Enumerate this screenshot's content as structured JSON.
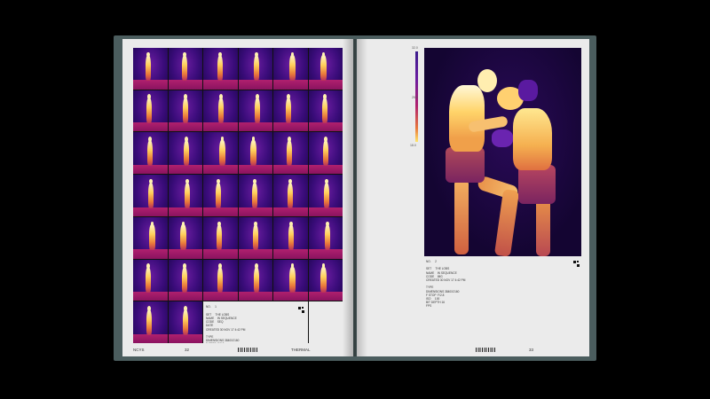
{
  "book": {
    "left_page": {
      "footer_left": "NCYS",
      "page_number": "32",
      "section": "THERMAL",
      "info_block": "NO.     1\n\nSET     THE LOBS\nNAME    IN SEQUENCE\nCODE    SEQ\nDATE    \nCREATED 30 NOV 17 4:42 PM\n\nTYPE    \nDIMENSIONS 3840X2160\nF STOP  F/2.8\nISO     100\nBIT DEPTH 16\nFPS     30\n\nDURATION 00:00:00:00:00:36"
    },
    "right_page": {
      "page_number": "33",
      "scale_top": "32.0",
      "scale_mid": "25.0",
      "scale_bottom": "18.0",
      "meta": "NO.     2\n\nSET     THE LOBS\nNAME    IN SEQUENCE\nCODE    IMG\nCREATED 30 NOV 17 4:42 PM\n\nTYPE    \nDIMENSIONS 3840X2160\nF STOP  F/2.8\nISO     100\nBIT DEPTH 16\nFPS     "
    }
  },
  "colors": {
    "background": "#000000",
    "cover": "#4b5d5e",
    "paper": "#ebebeb",
    "thermal_cold": "#1d0650",
    "thermal_hot": "#fff6c8"
  }
}
